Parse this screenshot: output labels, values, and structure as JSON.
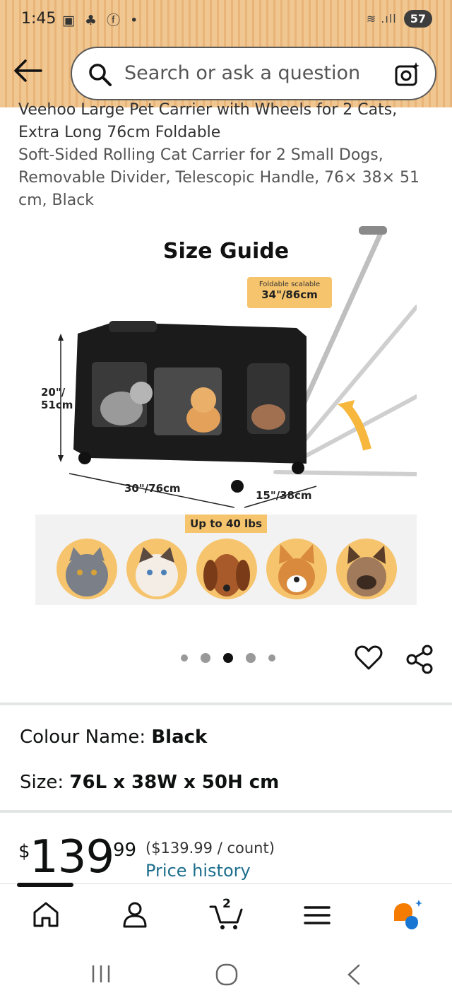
{
  "status_bar": {
    "time": "1:45",
    "battery": "57"
  },
  "search": {
    "placeholder": "Search or ask a question"
  },
  "product": {
    "title_line1": "Veehoo Large Pet Carrier with Wheels for 2 Cats,",
    "title_line2": "Extra Long 76cm Foldable",
    "subtitle": "Soft-Sided Rolling Cat Carrier for 2 Small Dogs, Removable Divider, Telescopic Handle, 76× 38× 51 cm, Black"
  },
  "image": {
    "heading": "Size Guide",
    "fold_label": "Foldable scalable",
    "fold_value": "34\"/86cm",
    "height_label": "20\"/",
    "height_value": "51cm",
    "length_label": "30\"/76cm",
    "width_label": "15\"/38cm",
    "weight_label": "Up to 40 lbs"
  },
  "carousel": {
    "count": 5,
    "active_index": 2
  },
  "details": {
    "colour_label": "Colour Name:",
    "colour_value": "Black",
    "size_label": "Size:",
    "size_value": "76L x 38W x 50H cm"
  },
  "price": {
    "currency": "$",
    "whole": "139",
    "fraction": "99",
    "unit_price": "($139.99 / count)",
    "history_link": "Price history"
  },
  "bottom_nav": {
    "cart_count": "2"
  },
  "colors": {
    "header_bg": "#f1c791",
    "link": "#1c6e8c",
    "accent_orange": "#f57c00",
    "accent_blue": "#1976d2",
    "tag_yellow": "#f6c46d"
  }
}
